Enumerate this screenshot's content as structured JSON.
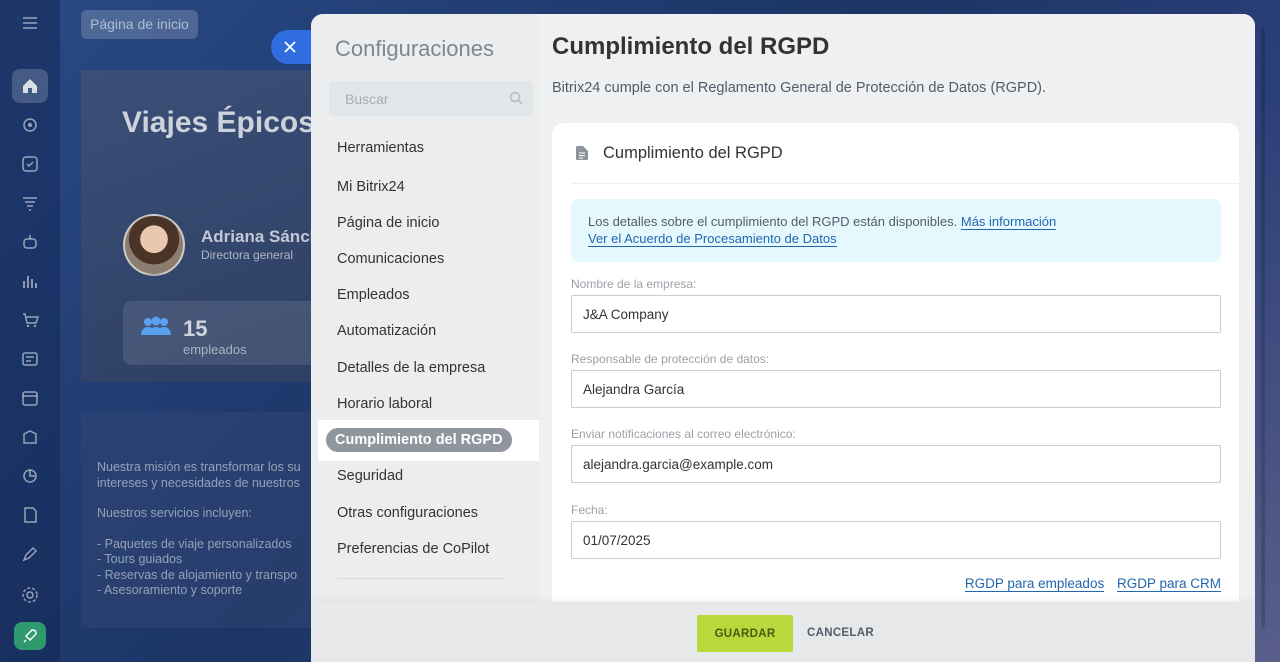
{
  "portal": {
    "home_chip": "Página de inicio",
    "company_title": "Viajes Épicos",
    "person_name": "Adriana Sánch",
    "person_role": "Directora general",
    "employee_count": "15",
    "employee_label": "empleados",
    "mission_lines": [
      "Nuestra misión es transformar los su",
      "intereses y necesidades de nuestros",
      "",
      "Nuestros servicios incluyen:",
      "",
      "- Paquetes de viaje personalizados",
      "- Tours guiados",
      "- Reservas de alojamiento y transpo",
      "- Asesoramiento y soporte"
    ],
    "left_rail_icons": [
      "menu-icon",
      "home-icon",
      "feed-icon",
      "tasks-icon",
      "crm-funnel-icon",
      "robot-icon",
      "analytics-icon",
      "cart-icon",
      "contact-center-icon",
      "calendar-icon",
      "sites-icon",
      "automation-icon",
      "sign-icon",
      "marketing-icon",
      "settings-icon",
      "rocket-icon"
    ]
  },
  "settings": {
    "menu_title": "Configuraciones",
    "search_placeholder": "Buscar",
    "menu_items": [
      "Herramientas",
      "Mi Bitrix24",
      "Página de inicio",
      "Comunicaciones",
      "Empleados",
      "Automatización",
      "Detalles de la empresa",
      "Horario laboral",
      "Cumplimiento del RGPD",
      "Seguridad",
      "Otras configuraciones",
      "Preferencias de CoPilot"
    ],
    "active_item": "Cumplimiento del RGPD"
  },
  "page": {
    "title": "Cumplimiento del RGPD",
    "description": "Bitrix24 cumple con el Reglamento General de Protección de Datos (RGPD).",
    "card_title": "Cumplimiento del RGPD",
    "info_text": "Los detalles sobre el cumplimiento del RGPD están disponibles.",
    "info_link_more": "Más información",
    "info_link_agreement": "Ver el Acuerdo de Procesamiento de Datos",
    "fields": {
      "company_label": "Nombre de la empresa:",
      "company_value": "J&A Company",
      "dpo_label": "Responsable de protección de datos:",
      "dpo_value": "Alejandra García",
      "email_label": "Enviar notificaciones al correo electrónico:",
      "email_value": "alejandra.garcia@example.com",
      "date_label": "Fecha:",
      "date_value": "01/07/2025"
    },
    "link_employees": "RGDP para empleados",
    "link_crm": "RGDP para CRM"
  },
  "footer": {
    "save_label": "GUARDAR",
    "cancel_label": "CANCELAR"
  },
  "colors": {
    "accent_blue": "#2f6de0",
    "save_green": "#b9d83c",
    "link_blue": "#2067b0",
    "info_bg": "#e5f8fd"
  }
}
